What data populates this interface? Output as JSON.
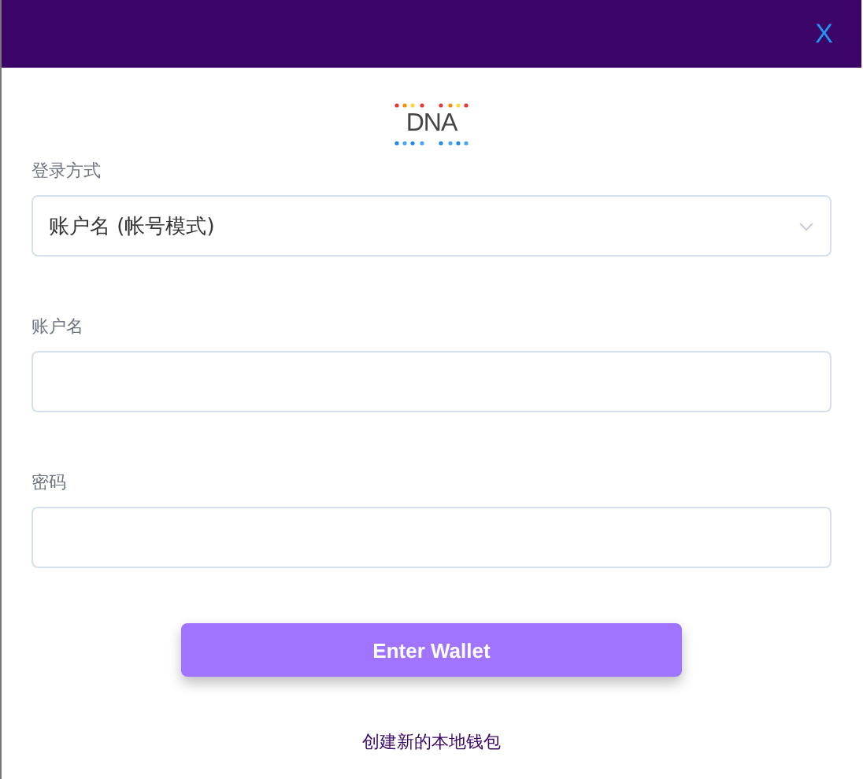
{
  "header": {
    "close": "X"
  },
  "logo": {
    "text": "DNA"
  },
  "fields": [
    {
      "kind": "select",
      "label": "登录方式",
      "value": "账户名 (帐号模式)"
    },
    {
      "kind": "input",
      "label": "账户名"
    },
    {
      "kind": "input",
      "label": "密码"
    }
  ],
  "submit": "Enter Wallet",
  "link": "创建新的本地钱包"
}
